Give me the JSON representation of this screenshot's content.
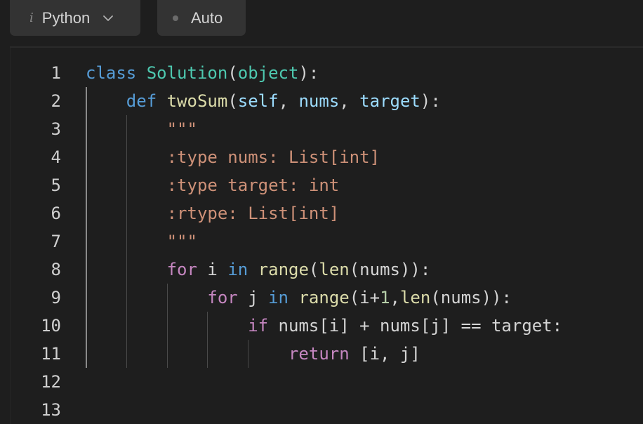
{
  "toolbar": {
    "language_label": "Python",
    "mode_label": "Auto",
    "info_glyph": "i"
  },
  "editor": {
    "line_numbers": [
      "1",
      "2",
      "3",
      "4",
      "5",
      "6",
      "7",
      "8",
      "9",
      "10",
      "11",
      "12",
      "13"
    ],
    "lines": [
      [
        {
          "t": "class",
          "c": "kw"
        },
        {
          "t": " ",
          "c": "op"
        },
        {
          "t": "Solution",
          "c": "cls"
        },
        {
          "t": "(",
          "c": "op"
        },
        {
          "t": "object",
          "c": "cls"
        },
        {
          "t": "):",
          "c": "op"
        }
      ],
      [
        {
          "t": "    ",
          "c": "op"
        },
        {
          "t": "def",
          "c": "kw"
        },
        {
          "t": " ",
          "c": "op"
        },
        {
          "t": "twoSum",
          "c": "fn"
        },
        {
          "t": "(",
          "c": "op"
        },
        {
          "t": "self",
          "c": "param"
        },
        {
          "t": ", ",
          "c": "op"
        },
        {
          "t": "nums",
          "c": "param"
        },
        {
          "t": ", ",
          "c": "op"
        },
        {
          "t": "target",
          "c": "param"
        },
        {
          "t": "):",
          "c": "op"
        }
      ],
      [
        {
          "t": "        ",
          "c": "op"
        },
        {
          "t": "\"\"\"",
          "c": "str"
        }
      ],
      [
        {
          "t": "        ",
          "c": "op"
        },
        {
          "t": ":type nums: List[int]",
          "c": "str"
        }
      ],
      [
        {
          "t": "        ",
          "c": "op"
        },
        {
          "t": ":type target: int",
          "c": "str"
        }
      ],
      [
        {
          "t": "        ",
          "c": "op"
        },
        {
          "t": ":rtype: List[int]",
          "c": "str"
        }
      ],
      [
        {
          "t": "        ",
          "c": "op"
        },
        {
          "t": "\"\"\"",
          "c": "str"
        }
      ],
      [
        {
          "t": "        ",
          "c": "op"
        },
        {
          "t": "for",
          "c": "ctl"
        },
        {
          "t": " i ",
          "c": "op"
        },
        {
          "t": "in",
          "c": "kw"
        },
        {
          "t": " ",
          "c": "op"
        },
        {
          "t": "range",
          "c": "fn"
        },
        {
          "t": "(",
          "c": "op"
        },
        {
          "t": "len",
          "c": "fn"
        },
        {
          "t": "(nums)):",
          "c": "op"
        }
      ],
      [
        {
          "t": "            ",
          "c": "op"
        },
        {
          "t": "for",
          "c": "ctl"
        },
        {
          "t": " j ",
          "c": "op"
        },
        {
          "t": "in",
          "c": "kw"
        },
        {
          "t": " ",
          "c": "op"
        },
        {
          "t": "range",
          "c": "fn"
        },
        {
          "t": "(i+",
          "c": "op"
        },
        {
          "t": "1",
          "c": "num"
        },
        {
          "t": ",",
          "c": "op"
        },
        {
          "t": "len",
          "c": "fn"
        },
        {
          "t": "(nums)):",
          "c": "op"
        }
      ],
      [
        {
          "t": "                ",
          "c": "op"
        },
        {
          "t": "if",
          "c": "ctl"
        },
        {
          "t": " nums[i] + nums[j] == target:",
          "c": "op"
        }
      ],
      [
        {
          "t": "                    ",
          "c": "op"
        },
        {
          "t": "return",
          "c": "ctl"
        },
        {
          "t": " [i, j]",
          "c": "op"
        }
      ],
      [],
      []
    ]
  },
  "colors": {
    "background": "#1e1e1e",
    "chip": "#333333",
    "keyword": "#569cd6",
    "control": "#c586c0",
    "class": "#4ec9b0",
    "function": "#dcdcaa",
    "parameter": "#9cdcfe",
    "string": "#ce9178",
    "number": "#b5cea8"
  }
}
